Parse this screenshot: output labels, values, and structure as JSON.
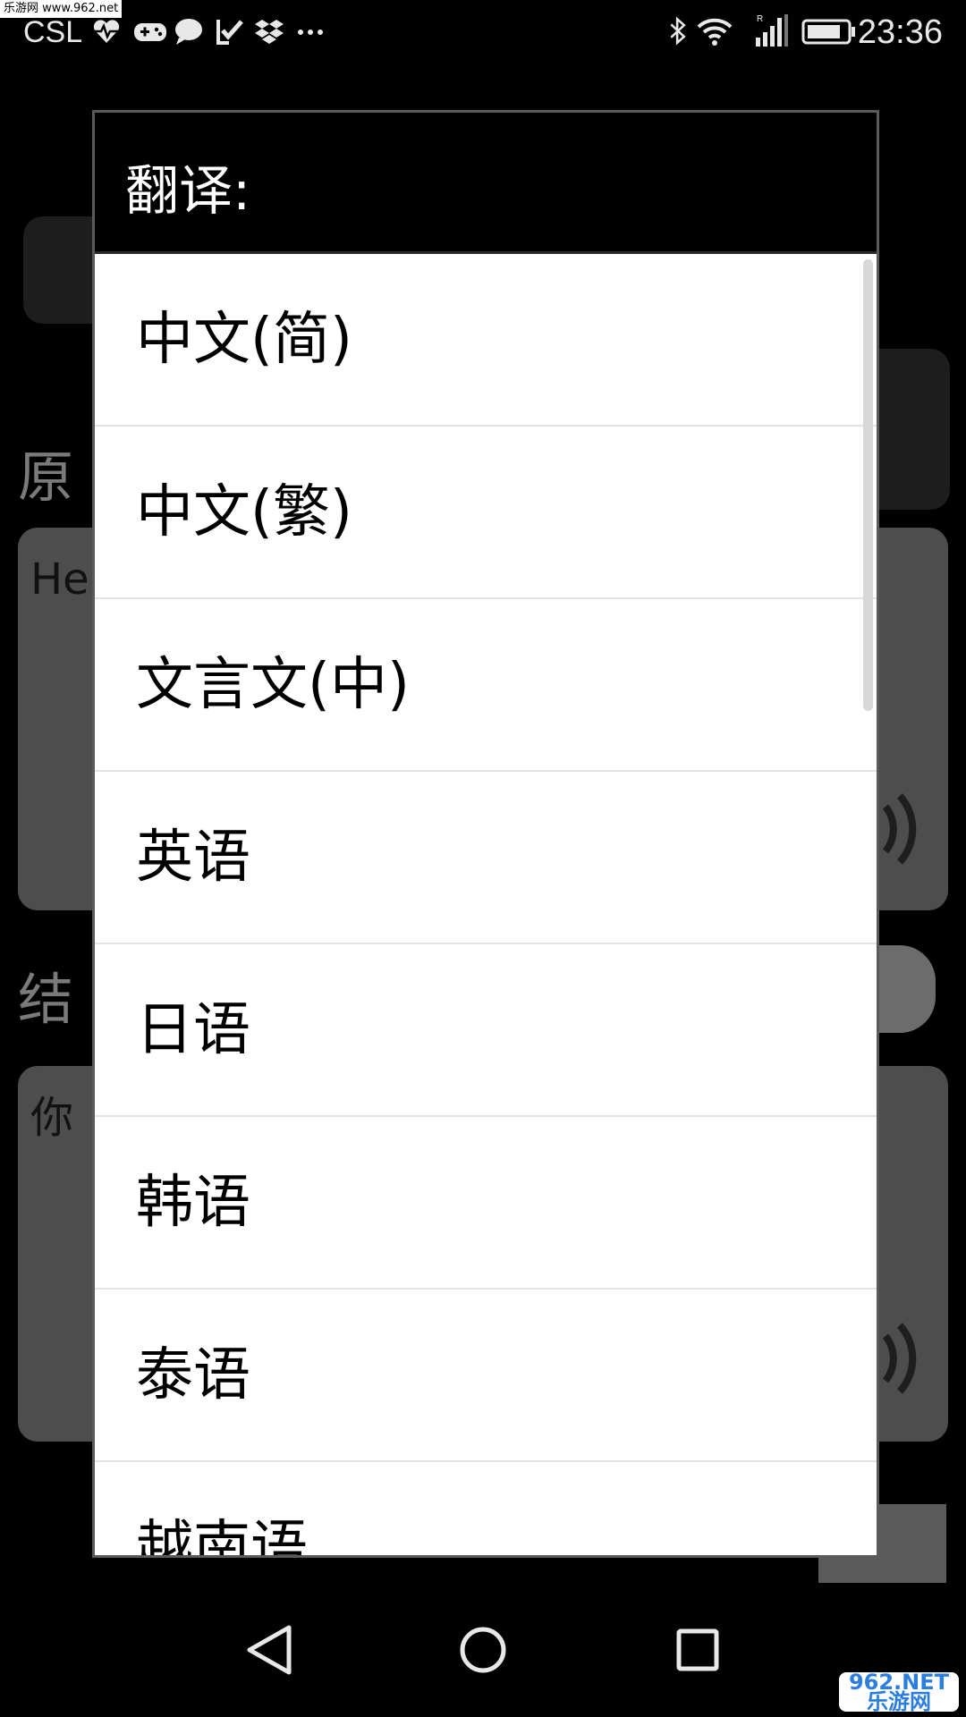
{
  "watermark_top": "乐游网 www.962.net",
  "status_bar": {
    "carrier": "CSL",
    "clock": "23:36",
    "notification_icons": [
      "heartbeat-icon",
      "gamepad-icon",
      "chat-bubble-icon",
      "check-badge-icon",
      "dropbox-icon",
      "more-dots-icon"
    ],
    "system_icons": [
      "bluetooth-icon",
      "wifi-icon",
      "signal-icon",
      "battery-icon"
    ]
  },
  "background_app": {
    "source_label_partial": "原",
    "source_text_partial": "He",
    "result_label_partial": "结",
    "result_text_partial": "你"
  },
  "dialog": {
    "title": "翻译:",
    "options": [
      {
        "label": "中文(简)"
      },
      {
        "label": "中文(繁)"
      },
      {
        "label": "文言文(中)"
      },
      {
        "label": "英语"
      },
      {
        "label": "日语"
      },
      {
        "label": "韩语"
      },
      {
        "label": "泰语"
      },
      {
        "label": "越南语"
      }
    ]
  },
  "nav_bar": {
    "buttons": [
      "back-icon",
      "home-icon",
      "recents-icon"
    ]
  },
  "watermark_bottom": {
    "line1": "962.NET",
    "line2": "乐游网"
  }
}
